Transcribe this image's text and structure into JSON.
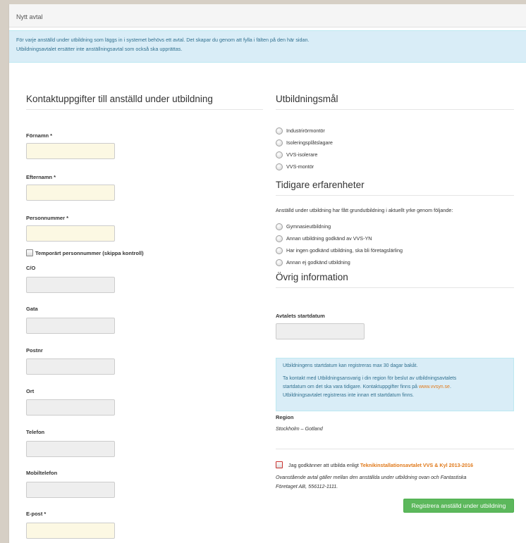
{
  "header": {
    "title": "Nytt avtal"
  },
  "intro": {
    "line1": "För varje anställd under utbildning som läggs in i systemet behövs ett avtal. Det skapar du genom att fylla i fälten på den här sidan.",
    "line2": "Utbildningsavtalet ersätter inte anställningsavtal som också ska upprättas."
  },
  "contact": {
    "title": "Kontaktuppgifter till anställd under utbildning",
    "firstname": {
      "label": "Förnamn *",
      "value": ""
    },
    "lastname": {
      "label": "Efternamn *",
      "value": ""
    },
    "personnummer": {
      "label": "Personnummer *",
      "value": ""
    },
    "temp_pnr": {
      "label": "Temporärt personnummer (skippa kontroll)"
    },
    "co": {
      "label": "C/O",
      "value": ""
    },
    "street": {
      "label": "Gata",
      "value": ""
    },
    "postnr": {
      "label": "Postnr",
      "value": ""
    },
    "city": {
      "label": "Ort",
      "value": ""
    },
    "phone": {
      "label": "Telefon",
      "value": ""
    },
    "mobile": {
      "label": "Mobiltelefon",
      "value": ""
    },
    "email": {
      "label": "E-post *",
      "value": ""
    }
  },
  "goals": {
    "title": "Utbildningsmål",
    "options": [
      "Industrirörmontör",
      "Isoleringsplåtslagare",
      "VVS-isolerare",
      "VVS-montör"
    ]
  },
  "experience": {
    "title": "Tidigare erfarenheter",
    "intro": "Anställd under utbildning har fått grundutbildning i aktuellt yrke genom följande:",
    "options": [
      "Gymnasieutbildning",
      "Annan utbildning godkänd av VVS-YN",
      "Har ingen godkänd utbildning, ska bli företagslärling",
      "Annan ej godkänd utbildning"
    ]
  },
  "other": {
    "title": "Övrig information",
    "start_label": "Avtalets startdatum",
    "start_value": "",
    "info_p1": "Utbildningens startdatum kan registreras max 30 dagar bakåt.",
    "info_p2a": "Ta kontakt med Utbildningsansvarig i din region för beslut av utbildningsavtalets",
    "info_p2b": "startdatum om det ska vara tidigare. Kontaktuppgifter finns på ",
    "info_link": "www.vvsyn.se",
    "info_p2c": ".",
    "info_p2d": "Utbildningsavtalet registreras inte innan ett startdatum finns.",
    "region_label": "Region",
    "region_value": "Stockholm – Gotland"
  },
  "agreement": {
    "prefix": "Jag godkänner att utbilda enligt ",
    "link": "Teknikinstallationsavtalet VVS & Kyl 2013-2016",
    "note1": "Ovanstående avtal gäller mellan den anställda under utbildning ovan och Fantastiska",
    "note2": "Företaget AB, 556112-1111.",
    "submit": "Registrera anställd under utbildning"
  },
  "colors": {
    "accent_green": "#5cb85c",
    "link_orange": "#e0791a",
    "info_blue": "#d9edf7",
    "required_yellow": "#fcf8e3"
  }
}
